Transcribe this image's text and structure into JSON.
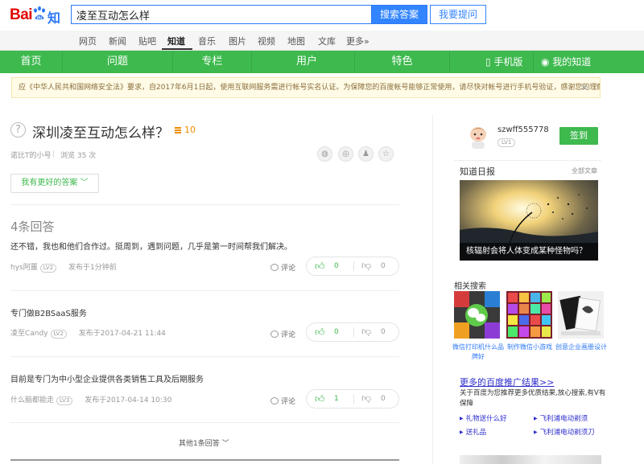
{
  "header": {
    "logo_text_bai": "Bai",
    "logo_text_du": "du",
    "logo_text_zhidao": "知道",
    "search_value": "凌至互动怎么样",
    "search_button": "搜索答案",
    "ask_button": "我要提问"
  },
  "product_nav": [
    {
      "label": "网页"
    },
    {
      "label": "新闻"
    },
    {
      "label": "贴吧"
    },
    {
      "label": "知道",
      "active": true
    },
    {
      "label": "音乐"
    },
    {
      "label": "图片"
    },
    {
      "label": "视频"
    },
    {
      "label": "地图"
    },
    {
      "label": "文库"
    },
    {
      "label": "更多»"
    }
  ],
  "green_nav": {
    "items": [
      "首页",
      "问题",
      "专栏",
      "用户",
      "特色"
    ],
    "mobile": "手机版",
    "mine": "我的知道"
  },
  "notice": {
    "text": "应《中华人民共和国网络安全法》要求，自2017年6月1日起，使用互联网服务需进行帐号实名认证。为保障您的百度帐号能够正常使用，请尽快对帐号进行手机号验证，感谢您的理解与支持。",
    "close": "✕"
  },
  "question": {
    "title": "深圳凌至互动怎么样？",
    "reward": "10",
    "asker": "诺比T的小号",
    "views": "浏览 35 次",
    "better_answer_button": "我有更好的答案 ﹀"
  },
  "answers_header": "4条回答",
  "answers": [
    {
      "text": "还不错，我也和他们合作过。挺周到，遇到问题，几乎是第一时间帮我们解决。",
      "author": "hys阿噩",
      "level": "LV2",
      "time": "发布于1分钟前",
      "comment": "评论",
      "up": "0",
      "down": "0"
    },
    {
      "text": "专门做B2BSaaS服务",
      "author": "凌至Candy",
      "level": "LV2",
      "time": "发布于2017-04-21 11:44",
      "comment": "评论",
      "up": "0",
      "down": "0"
    },
    {
      "text": "目前是专门为中小型企业提供各类销售工具及后期服务",
      "author": "什么脑都能走",
      "level": "LV3",
      "time": "发布于2017-04-14 10:30",
      "comment": "评论",
      "up": "1",
      "down": "0"
    }
  ],
  "more_answers": "其他1条回答 ﹀",
  "sidebar": {
    "username": "szwff555778",
    "user_level": "LV1",
    "signin": "签到",
    "daily_title": "知道日报",
    "daily_all": "全部文章",
    "daily_caption": "核辐射会将人体变成某种怪物吗？",
    "related_title": "相关搜索",
    "related": [
      {
        "label": "微信打印机什么品牌好"
      },
      {
        "label": "制作微信小游戏"
      },
      {
        "label": "创意企业画册设计"
      }
    ],
    "promo_title": "更多的百度推广结果>>",
    "promo_desc": "关于百度为您推荐更多优质结果,放心搜索,有V有保障",
    "promo_links": [
      "礼物送什么好",
      "飞利浦电动剃须",
      "送礼品",
      "飞利浦电动剃须刀"
    ]
  },
  "colors": {
    "brand_green": "#3eb94e",
    "brand_blue": "#3385ff",
    "baidu_red": "#e10602",
    "reward_orange": "#f08c00"
  }
}
